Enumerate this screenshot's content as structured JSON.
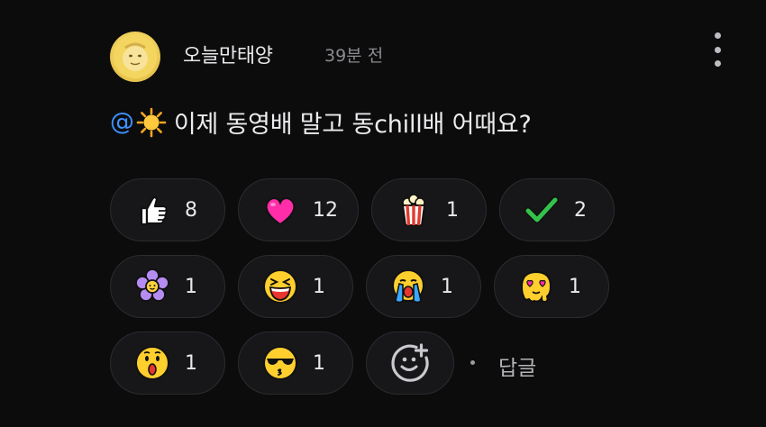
{
  "comment": {
    "username": "오늘만태양",
    "timestamp": "39분 전",
    "mention": "@",
    "mention_emoji": "sun-emoji",
    "text": " 이제 동영배 말고 동chill배 어때요?",
    "reply_label": "답글",
    "reply_separator": "·"
  },
  "reactions": [
    {
      "icon": "thumbs-up-emoji",
      "count": "8"
    },
    {
      "icon": "heart-emoji",
      "count": "12"
    },
    {
      "icon": "popcorn-emoji",
      "count": "1"
    },
    {
      "icon": "checkmark-emoji",
      "count": "2"
    },
    {
      "icon": "flower-emoji",
      "count": "1"
    },
    {
      "icon": "laughing-face-emoji",
      "count": "1"
    },
    {
      "icon": "crying-face-emoji",
      "count": "1"
    },
    {
      "icon": "melting-heart-eyes-emoji",
      "count": "1"
    },
    {
      "icon": "surprised-face-emoji",
      "count": "1"
    },
    {
      "icon": "sunglasses-kiss-emoji",
      "count": "1"
    }
  ],
  "add_reaction_icon": "add-emoji-icon",
  "colors": {
    "background": "#0c0c0d",
    "chip_background": "#17171a",
    "chip_border": "#2c2c30",
    "mention": "#3d93ff",
    "text": "#ececee",
    "muted": "#8b8b90"
  }
}
